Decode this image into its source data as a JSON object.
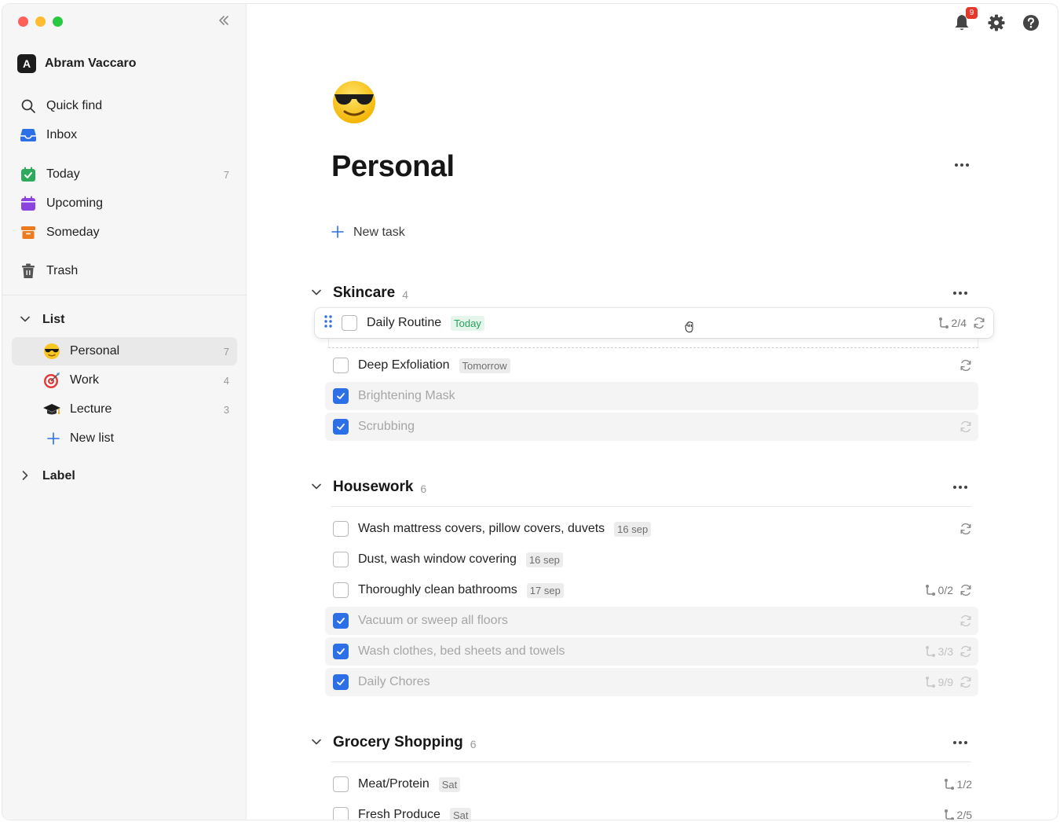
{
  "window": {
    "collapse_icon": "chevrons-left-icon"
  },
  "user": {
    "initial": "A",
    "name": "Abram Vaccaro"
  },
  "nav": {
    "quick_find": "Quick find",
    "inbox": "Inbox",
    "today": {
      "label": "Today",
      "count": "7"
    },
    "upcoming": "Upcoming",
    "someday": "Someday",
    "trash": "Trash"
  },
  "lists": {
    "header": "List",
    "items": [
      {
        "label": "Personal",
        "count": "7",
        "icon": "sunglasses-emoji"
      },
      {
        "label": "Work",
        "count": "4",
        "icon": "target-emoji"
      },
      {
        "label": "Lecture",
        "count": "3",
        "icon": "graduation-cap-emoji"
      }
    ],
    "new_list": "New list"
  },
  "labels": {
    "header": "Label"
  },
  "topbar": {
    "notification_count": "9"
  },
  "page": {
    "emoji": "sunglasses-emoji",
    "title": "Personal",
    "new_task": "New task"
  },
  "groups": [
    {
      "title": "Skincare",
      "count": "4",
      "tasks": [
        {
          "name": "Daily Routine",
          "tag": "Today",
          "subtasks": "2/4",
          "repeat": true,
          "done": false,
          "dragging": true
        },
        {
          "name": "Deep Exfoliation",
          "tag": "Tomorrow",
          "repeat": true,
          "done": false
        },
        {
          "name": "Brightening Mask",
          "done": true
        },
        {
          "name": "Scrubbing",
          "repeat": true,
          "done": true
        }
      ]
    },
    {
      "title": "Housework",
      "count": "6",
      "tasks": [
        {
          "name": "Wash mattress covers, pillow covers, duvets",
          "tag": "16 sep",
          "repeat": true,
          "done": false
        },
        {
          "name": "Dust, wash window covering",
          "tag": "16 sep",
          "done": false
        },
        {
          "name": "Thoroughly clean bathrooms",
          "tag": "17 sep",
          "subtasks": "0/2",
          "repeat": true,
          "done": false
        },
        {
          "name": "Vacuum or sweep all floors",
          "repeat": true,
          "done": true
        },
        {
          "name": "Wash clothes, bed sheets and towels",
          "subtasks": "3/3",
          "repeat": true,
          "done": true
        },
        {
          "name": "Daily Chores",
          "subtasks": "9/9",
          "repeat": true,
          "done": true
        }
      ]
    },
    {
      "title": "Grocery Shopping",
      "count": "6",
      "tasks": [
        {
          "name": "Meat/Protein",
          "tag": "Sat",
          "subtasks": "1/2",
          "done": false
        },
        {
          "name": "Fresh Produce",
          "tag": "Sat",
          "subtasks": "2/5",
          "done": false
        }
      ]
    }
  ],
  "colors": {
    "accent": "#2c6fe6",
    "today_tag": "#25a45a",
    "badge": "#e5382b"
  }
}
